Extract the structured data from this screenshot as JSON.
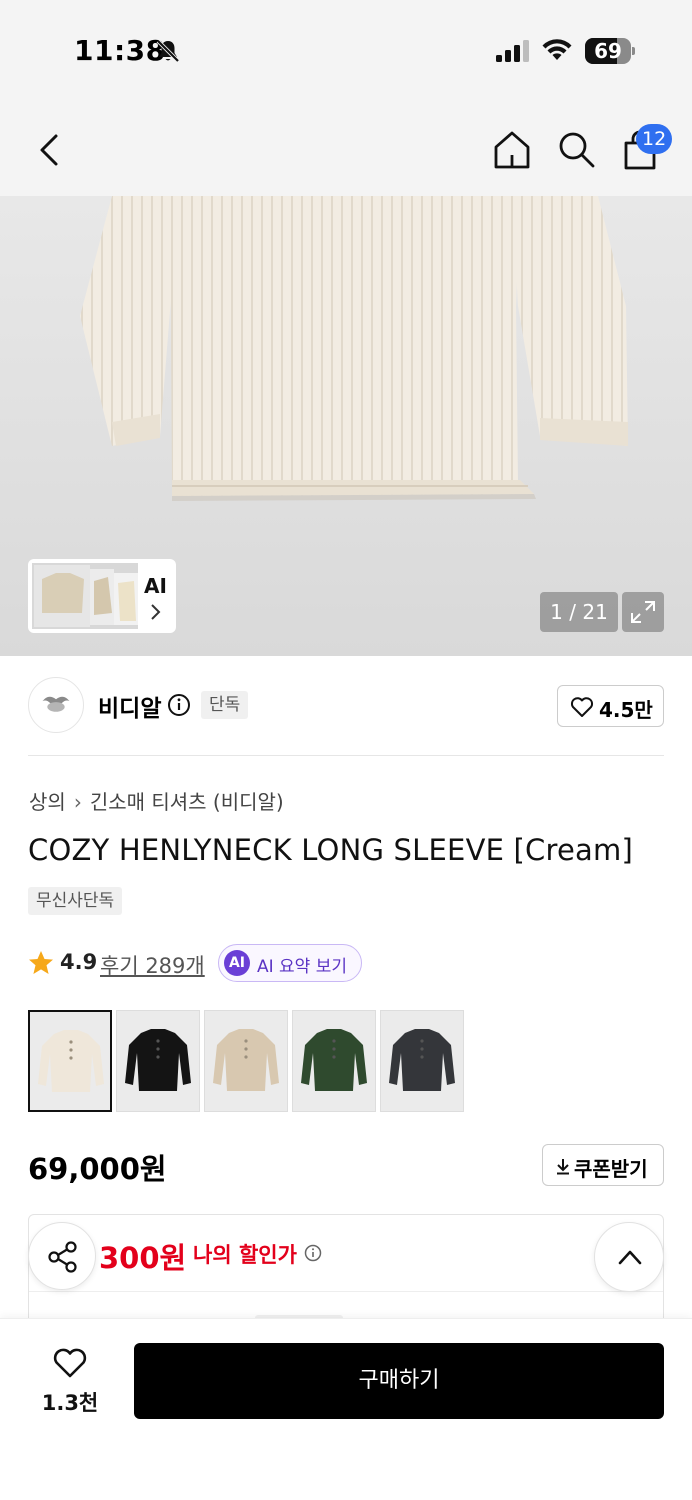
{
  "status_bar": {
    "time": "11:38",
    "battery_level": "69",
    "battery_fraction": 0.69
  },
  "nav": {
    "cart_count": "12",
    "icons": [
      "back-icon",
      "home-icon",
      "search-icon",
      "cart-icon"
    ]
  },
  "gallery": {
    "ai_label": "AI",
    "page_indicator": "1 / 21"
  },
  "brand": {
    "name": "비디알",
    "exclusive_tag": "단독",
    "like_count": "4.5만"
  },
  "breadcrumb": {
    "category": "상의",
    "subcategory": "긴소매 티셔츠 (비디알)"
  },
  "product": {
    "title": "COZY HENLYNECK LONG SLEEVE [Cream]",
    "exclusive_badge": "무신사단독",
    "rating": "4.9",
    "review_link": "후기 289개",
    "ai_badge": "AI",
    "ai_summary": "AI 요약 보기",
    "color_options": [
      {
        "color": "#efe7da",
        "selected": true
      },
      {
        "color": "#141414",
        "selected": false
      },
      {
        "color": "#d8c8b0",
        "selected": false
      },
      {
        "color": "#2f4a2e",
        "selected": false
      },
      {
        "color": "#34363a",
        "selected": false
      }
    ],
    "price": "69,000원",
    "coupon_label": "쿠폰받기"
  },
  "discount": {
    "amount": "300원",
    "label": "나의 할인가"
  },
  "bottom_bar": {
    "wish_count": "1.3천",
    "buy_label": "구매하기"
  },
  "colors": {
    "accent_blue": "#2f6ff0",
    "discount_red": "#e3001b",
    "ai_purple": "#6a3fd6"
  }
}
